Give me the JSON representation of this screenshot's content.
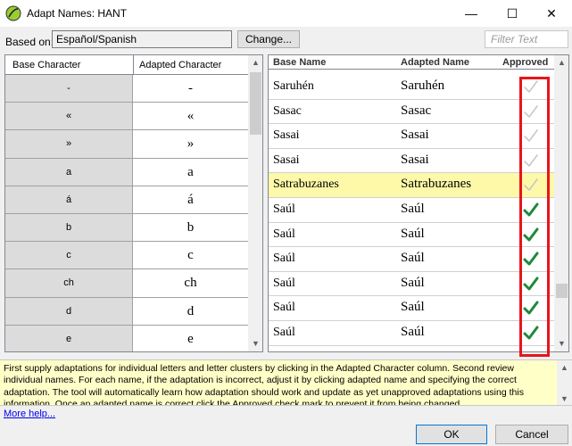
{
  "window": {
    "title": "Adapt Names: HANT",
    "minimize_glyph": "—",
    "maximize_glyph": "☐",
    "close_glyph": "✕"
  },
  "toolbar": {
    "based_on_label": "Based on:",
    "based_on_value": "Español/Spanish",
    "change_label": "Change...",
    "filter_placeholder": "Filter Text"
  },
  "characters": {
    "headers": [
      "Base Character",
      "Adapted Character"
    ],
    "rows": [
      {
        "base": "-",
        "adapted": "-"
      },
      {
        "base": "«",
        "adapted": "«"
      },
      {
        "base": "»",
        "adapted": "»"
      },
      {
        "base": "a",
        "adapted": "a"
      },
      {
        "base": "á",
        "adapted": "á"
      },
      {
        "base": "b",
        "adapted": "b"
      },
      {
        "base": "c",
        "adapted": "c"
      },
      {
        "base": "ch",
        "adapted": "ch"
      },
      {
        "base": "d",
        "adapted": "d"
      },
      {
        "base": "e",
        "adapted": "e"
      }
    ]
  },
  "names": {
    "headers": [
      "Base Name",
      "Adapted Name",
      "Approved"
    ],
    "rows": [
      {
        "base": "Saruhén",
        "adapted": "Saruhén",
        "approved": false,
        "selected": false
      },
      {
        "base": "Sasac",
        "adapted": "Sasac",
        "approved": false,
        "selected": false
      },
      {
        "base": "Sasai",
        "adapted": "Sasai",
        "approved": false,
        "selected": false
      },
      {
        "base": "Sasai",
        "adapted": "Sasai",
        "approved": false,
        "selected": false
      },
      {
        "base": "Satrabuzanes",
        "adapted": "Satrabuzanes",
        "approved": false,
        "selected": true
      },
      {
        "base": "Saúl",
        "adapted": "Saúl",
        "approved": true,
        "selected": false
      },
      {
        "base": "Saúl",
        "adapted": "Saúl",
        "approved": true,
        "selected": false
      },
      {
        "base": "Saúl",
        "adapted": "Saúl",
        "approved": true,
        "selected": false
      },
      {
        "base": "Saúl",
        "adapted": "Saúl",
        "approved": true,
        "selected": false
      },
      {
        "base": "Saúl",
        "adapted": "Saúl",
        "approved": true,
        "selected": false
      },
      {
        "base": "Saúl",
        "adapted": "Saúl",
        "approved": true,
        "selected": false
      }
    ]
  },
  "help": {
    "text": "First supply adaptations for individual letters and letter clusters by clicking in the Adapted Character column. Second review individual names. For each name, if the adaptation is incorrect, adjust it by clicking adapted name and specifying the correct adaptation. The tool will automatically learn how adaptation should work and update as yet unapproved adaptations using this information. Once an adapted name is correct click the Approved check mark to prevent it from being changed.",
    "more_help": "More help..."
  },
  "buttons": {
    "ok": "OK",
    "cancel": "Cancel"
  },
  "colors": {
    "selected_row": "#fdf9a8",
    "approved_check": "#1e8a3a",
    "unapproved_check": "#c8c8c8",
    "highlight_box": "#e8151b",
    "help_background": "#ffffc8"
  },
  "icons": {
    "app": "leaf-icon",
    "approved": "checkmark-icon"
  }
}
